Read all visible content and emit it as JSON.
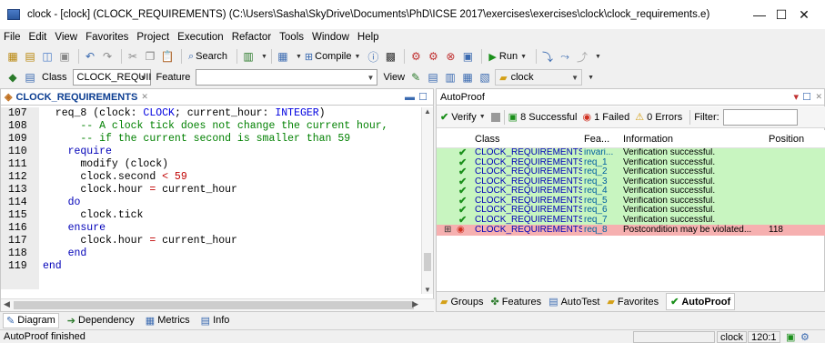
{
  "window": {
    "title": "clock - [clock] (CLOCK_REQUIREMENTS) (C:\\Users\\Sasha\\SkyDrive\\Documents\\PhD\\ICSE 2017\\exercises\\exercises\\clock\\clock_requirements.e)",
    "minimize": "—",
    "maximize": "☐",
    "close": "✕"
  },
  "menu": [
    "File",
    "Edit",
    "View",
    "Favorites",
    "Project",
    "Execution",
    "Refactor",
    "Tools",
    "Window",
    "Help"
  ],
  "toolbar": {
    "search_label": "Search",
    "compile_label": "Compile",
    "run_label": "Run"
  },
  "address_bar": {
    "class_label": "Class",
    "class_value": "CLOCK_REQUII",
    "feature_label": "Feature",
    "feature_value": "",
    "view_label": "View",
    "cluster_value": "clock"
  },
  "editor": {
    "tab_title": "CLOCK_REQUIREMENTS",
    "lines": [
      {
        "n": "107",
        "text": "  req_8 (clock: CLOCK; current_hour: INTEGER)"
      },
      {
        "n": "108",
        "text": "      -- A clock tick does not change the current hour,"
      },
      {
        "n": "109",
        "text": "      -- if the current second is smaller than 59"
      },
      {
        "n": "110",
        "text": "    require"
      },
      {
        "n": "111",
        "text": "      modify (clock)"
      },
      {
        "n": "112",
        "text": "      clock.second < 59"
      },
      {
        "n": "113",
        "text": "      clock.hour = current_hour"
      },
      {
        "n": "114",
        "text": "    do"
      },
      {
        "n": "115",
        "text": "      clock.tick"
      },
      {
        "n": "116",
        "text": "    ensure"
      },
      {
        "n": "117",
        "text": "      clock.hour = current_hour"
      },
      {
        "n": "118",
        "text": "    end"
      },
      {
        "n": "119",
        "text": "end"
      }
    ]
  },
  "autoproof": {
    "pane_title": "AutoProof",
    "verify_label": "Verify",
    "successful_label": "8 Successful",
    "failed_label": "1 Failed",
    "errors_label": "0 Errors",
    "filter_label": "Filter:",
    "columns": [
      "Class",
      "Fea...",
      "Information",
      "Position"
    ],
    "rows": [
      {
        "class": "CLOCK_REQUIREMENTS",
        "feature": "invari...",
        "info": "Verification successful.",
        "position": "",
        "status": "ok"
      },
      {
        "class": "CLOCK_REQUIREMENTS",
        "feature": "req_1",
        "info": "Verification successful.",
        "position": "",
        "status": "ok"
      },
      {
        "class": "CLOCK_REQUIREMENTS",
        "feature": "req_2",
        "info": "Verification successful.",
        "position": "",
        "status": "ok"
      },
      {
        "class": "CLOCK_REQUIREMENTS",
        "feature": "req_3",
        "info": "Verification successful.",
        "position": "",
        "status": "ok"
      },
      {
        "class": "CLOCK_REQUIREMENTS",
        "feature": "req_4",
        "info": "Verification successful.",
        "position": "",
        "status": "ok"
      },
      {
        "class": "CLOCK_REQUIREMENTS",
        "feature": "req_5",
        "info": "Verification successful.",
        "position": "",
        "status": "ok"
      },
      {
        "class": "CLOCK_REQUIREMENTS",
        "feature": "req_6",
        "info": "Verification successful.",
        "position": "",
        "status": "ok"
      },
      {
        "class": "CLOCK_REQUIREMENTS",
        "feature": "req_7",
        "info": "Verification successful.",
        "position": "",
        "status": "ok"
      },
      {
        "class": "CLOCK_REQUIREMENTS",
        "feature": "req_8",
        "info": "Postcondition may be violated...",
        "position": "118",
        "status": "fail"
      }
    ],
    "bottom_tabs": [
      "Groups",
      "Features",
      "AutoTest",
      "Favorites",
      "AutoProof"
    ]
  },
  "left_bottom_tabs": [
    "Diagram",
    "Dependency",
    "Metrics",
    "Info"
  ],
  "status": {
    "message": "AutoProof finished",
    "project": "clock",
    "cursor": "120:1"
  },
  "colors": {
    "ok_row": "#c8f5c0",
    "fail_row": "#f6b0b0",
    "keyword": "#0000b8",
    "comment": "#008000"
  }
}
